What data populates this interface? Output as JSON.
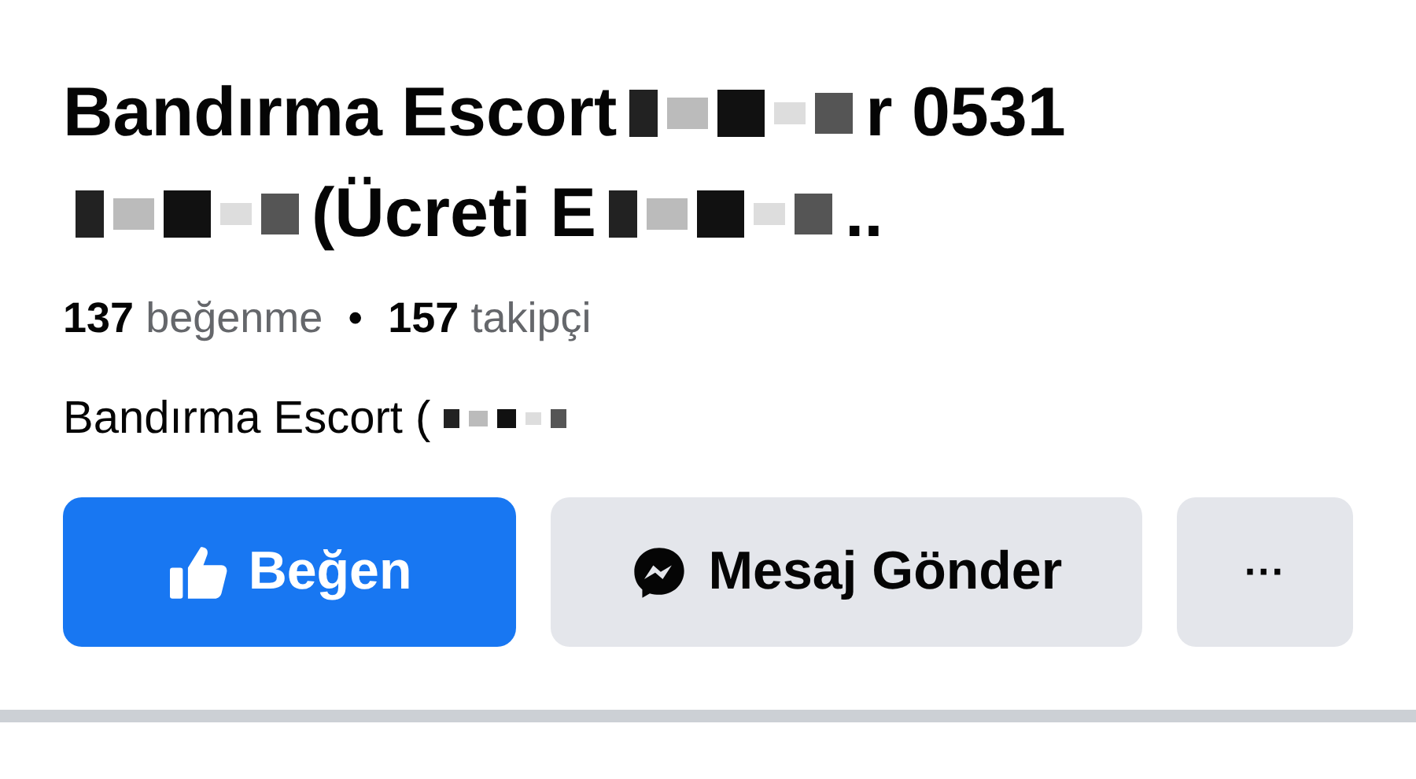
{
  "page": {
    "title_lines": [
      [
        {
          "kind": "text",
          "text": "Bandırma Escort"
        },
        {
          "kind": "redacted"
        },
        {
          "kind": "text",
          "text": "r 0531"
        }
      ],
      [
        {
          "kind": "redacted"
        },
        {
          "kind": "text",
          "text": "(Ücreti E"
        },
        {
          "kind": "redacted"
        },
        {
          "kind": "text",
          "text": ".."
        }
      ]
    ],
    "likes_count": "137",
    "likes_label": "beğenme",
    "separator": "•",
    "followers_count": "157",
    "followers_label": "takipçi",
    "category": [
      {
        "kind": "text",
        "text": "Bandırma Escort ("
      },
      {
        "kind": "redacted"
      }
    ],
    "buttons": [
      {
        "kind": "like",
        "label": "Beğen"
      },
      {
        "kind": "message",
        "label": "Mesaj Gönder"
      },
      {
        "kind": "more",
        "label": "···"
      }
    ]
  }
}
